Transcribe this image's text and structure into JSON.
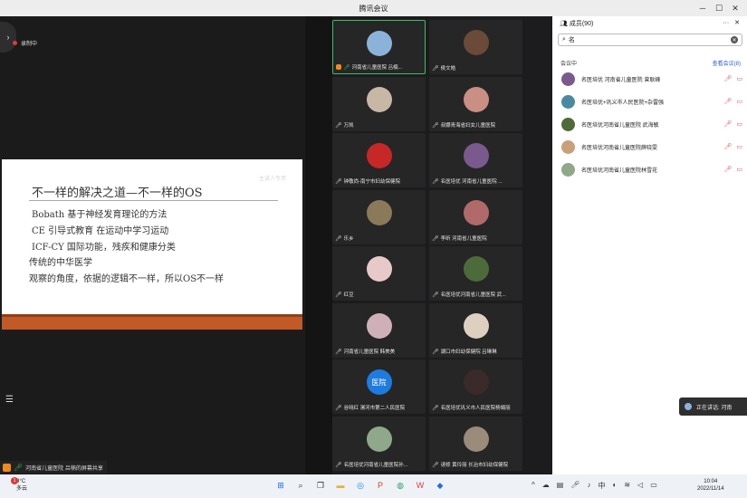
{
  "window": {
    "title": "腾讯会议"
  },
  "recording": {
    "label": "录制中"
  },
  "slide": {
    "watermark": "主讲人专用",
    "title": "不一样的解决之道—不一样的OS",
    "lines": [
      "Bobath 基于神经发育理论的方法",
      "CE 引导式教育 在运动中学习运动",
      "ICF-CY 国际功能，残疾和健康分类",
      "传统的中华医学",
      "观察的角度，依据的逻辑不一样，所以OS不一样"
    ]
  },
  "sharer": {
    "label": "河南省儿童医院 吕楠的屏幕共享"
  },
  "tiles": [
    {
      "name": "河南省儿童医院 吕楠...",
      "color": "#8bb3d9"
    },
    {
      "name": "侯文皓",
      "color": "#6b4a3a"
    },
    {
      "name": "万凯",
      "color": "#c9b7a6"
    },
    {
      "name": "叔娜青海省妇女儿童医院",
      "color": "#c98f84"
    },
    {
      "name": "钟敬尚-南宁市妇幼保健院",
      "color": "#c62828"
    },
    {
      "name": "名医培优  河南省儿童医院 ...",
      "color": "#7a5a8c"
    },
    {
      "name": "乐乡",
      "color": "#8a7a5a"
    },
    {
      "name": "李昕  河南省儿童医院",
      "color": "#b06a6a"
    },
    {
      "name": "红豆",
      "color": "#e8c9c9"
    },
    {
      "name": "名医培优河南省儿童医院 武...",
      "color": "#4d6b3a"
    },
    {
      "name": "河南省儿童医院 韩美美",
      "color": "#d0b0b8"
    },
    {
      "name": "湖口市妇幼保健院 吕琳琳",
      "color": "#ddd0c0"
    },
    {
      "name": "谷晓红 漯河市第二人民医院",
      "color": "#1e7be0",
      "text": "医院"
    },
    {
      "name": "名医培优巩义市人民医院杨娟丽",
      "color": "#3b2a2a"
    },
    {
      "name": "名医培优河南省儿童医院孙...",
      "color": "#8fa88a"
    },
    {
      "name": "请修 黄玲丽 长治市妇幼保健院",
      "color": "#9a8b7a"
    }
  ],
  "panel": {
    "header": "成员(90)",
    "search_value": "名",
    "section": "会议中",
    "view_all": "查看会议(8)",
    "participants": [
      {
        "name": "名医培优  河南省儿童医院 曾耿峰",
        "color": "#7a5a8c"
      },
      {
        "name": "名医培优+巩义市人民医院+杂雷强",
        "color": "#4a8aa0"
      },
      {
        "name": "名医培优河南省儿童医院 武海敏",
        "color": "#4d6b3a"
      },
      {
        "name": "名医培优河南省儿童医院薛晓雯",
        "color": "#c9a07a"
      },
      {
        "name": "名医培优河南省儿童医院林雪花",
        "color": "#8fa88a"
      }
    ]
  },
  "speaking": {
    "label": "正在讲话: 河南"
  },
  "taskbar": {
    "weather_temp": "9°C",
    "weather_desc": "多云",
    "weather_badge": "1",
    "time": "10:04",
    "date": "2022/11/14"
  }
}
